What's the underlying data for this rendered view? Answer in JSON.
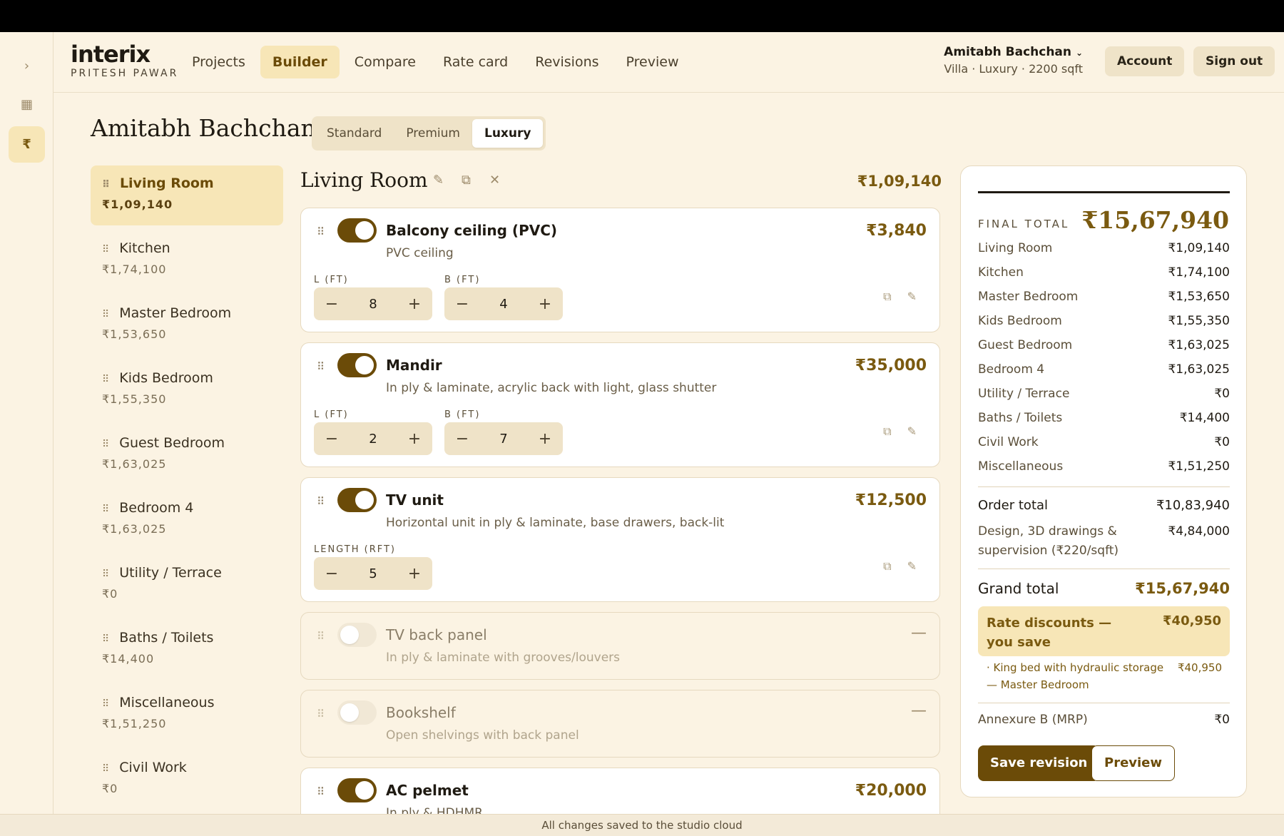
{
  "brand": {
    "name": "interix",
    "subtitle": "PRITESH PAWAR"
  },
  "rail": {
    "expand_glyph": "›",
    "grid_glyph": "▦",
    "rupee_glyph": "₹"
  },
  "nav": [
    "Projects",
    "Builder",
    "Compare",
    "Rate card",
    "Revisions",
    "Preview"
  ],
  "nav_active": "Builder",
  "user": {
    "name": "Amitabh Bachchan",
    "chevron": "⌄",
    "meta": "Villa · Luxury · 2200 sqft"
  },
  "header_buttons": {
    "account": "Account",
    "signout": "Sign out"
  },
  "client_title": "Amitabh Bachchan",
  "tiers": [
    "Standard",
    "Premium",
    "Luxury"
  ],
  "tier_active": "Luxury",
  "rooms": [
    {
      "name": "Living Room",
      "amount": "₹1,09,140",
      "active": true
    },
    {
      "name": "Kitchen",
      "amount": "₹1,74,100"
    },
    {
      "name": "Master Bedroom",
      "amount": "₹1,53,650"
    },
    {
      "name": "Kids Bedroom",
      "amount": "₹1,55,350"
    },
    {
      "name": "Guest Bedroom",
      "amount": "₹1,63,025"
    },
    {
      "name": "Bedroom 4",
      "amount": "₹1,63,025"
    },
    {
      "name": "Utility / Terrace",
      "amount": "₹0"
    },
    {
      "name": "Baths / Toilets",
      "amount": "₹14,400"
    },
    {
      "name": "Miscellaneous",
      "amount": "₹1,51,250"
    },
    {
      "name": "Civil Work",
      "amount": "₹0"
    }
  ],
  "section": {
    "title": "Living Room",
    "total": "₹1,09,140",
    "edit_glyph": "✎",
    "copy_glyph": "⧉",
    "close_glyph": "✕"
  },
  "items": [
    {
      "name": "Balcony ceiling (PVC)",
      "desc": "PVC ceiling",
      "price": "₹3,840",
      "enabled": true,
      "dims": [
        {
          "label": "L (FT)",
          "value": "8"
        },
        {
          "label": "B (FT)",
          "value": "4"
        }
      ]
    },
    {
      "name": "Mandir",
      "desc": "In ply & laminate, acrylic back with light, glass shutter",
      "price": "₹35,000",
      "enabled": true,
      "dims": [
        {
          "label": "L (FT)",
          "value": "2"
        },
        {
          "label": "B (FT)",
          "value": "7"
        }
      ]
    },
    {
      "name": "TV unit",
      "desc": "Horizontal unit in ply & laminate, base drawers, back-lit",
      "price": "₹12,500",
      "enabled": true,
      "dims": [
        {
          "label": "LENGTH (RFT)",
          "value": "5"
        }
      ]
    },
    {
      "name": "TV back panel",
      "desc": "In ply & laminate with grooves/louvers",
      "enabled": false
    },
    {
      "name": "Bookshelf",
      "desc": "Open shelvings with back panel",
      "enabled": false
    },
    {
      "name": "AC pelmet",
      "desc": "In ply & HDHMR",
      "price": "₹20,000",
      "enabled": true
    }
  ],
  "stepper": {
    "minus": "−",
    "plus": "+"
  },
  "item_minus": "—",
  "summary": {
    "final_label": "FINAL TOTAL",
    "final_value": "₹15,67,940",
    "rows": [
      {
        "label": "Living Room",
        "value": "₹1,09,140"
      },
      {
        "label": "Kitchen",
        "value": "₹1,74,100"
      },
      {
        "label": "Master Bedroom",
        "value": "₹1,53,650"
      },
      {
        "label": "Kids Bedroom",
        "value": "₹1,55,350"
      },
      {
        "label": "Guest Bedroom",
        "value": "₹1,63,025"
      },
      {
        "label": "Bedroom 4",
        "value": "₹1,63,025"
      },
      {
        "label": "Utility / Terrace",
        "value": "₹0"
      },
      {
        "label": "Baths / Toilets",
        "value": "₹14,400"
      },
      {
        "label": "Civil Work",
        "value": "₹0"
      },
      {
        "label": "Miscellaneous",
        "value": "₹1,51,250"
      }
    ],
    "order_total_label": "Order total",
    "order_total_value": "₹10,83,940",
    "design_label": "Design, 3D drawings & supervision (₹220/sqft)",
    "design_value": "₹4,84,000",
    "grand_total_label": "Grand total",
    "grand_total_value": "₹15,67,940",
    "discount_label": "Rate discounts — you save",
    "discount_value": "₹40,950",
    "discount_item_label": "· King bed with hydraulic storage — Master Bedroom",
    "discount_item_value": "₹40,950",
    "annexure_label": "Annexure B (MRP)",
    "annexure_value": "₹0",
    "save_label": "Save revision",
    "preview_label": "Preview"
  },
  "status": "All changes saved to the studio cloud",
  "colors": {
    "accent": "#6b4b08",
    "background": "#fbf3e3",
    "highlight": "#f7e6b7"
  }
}
